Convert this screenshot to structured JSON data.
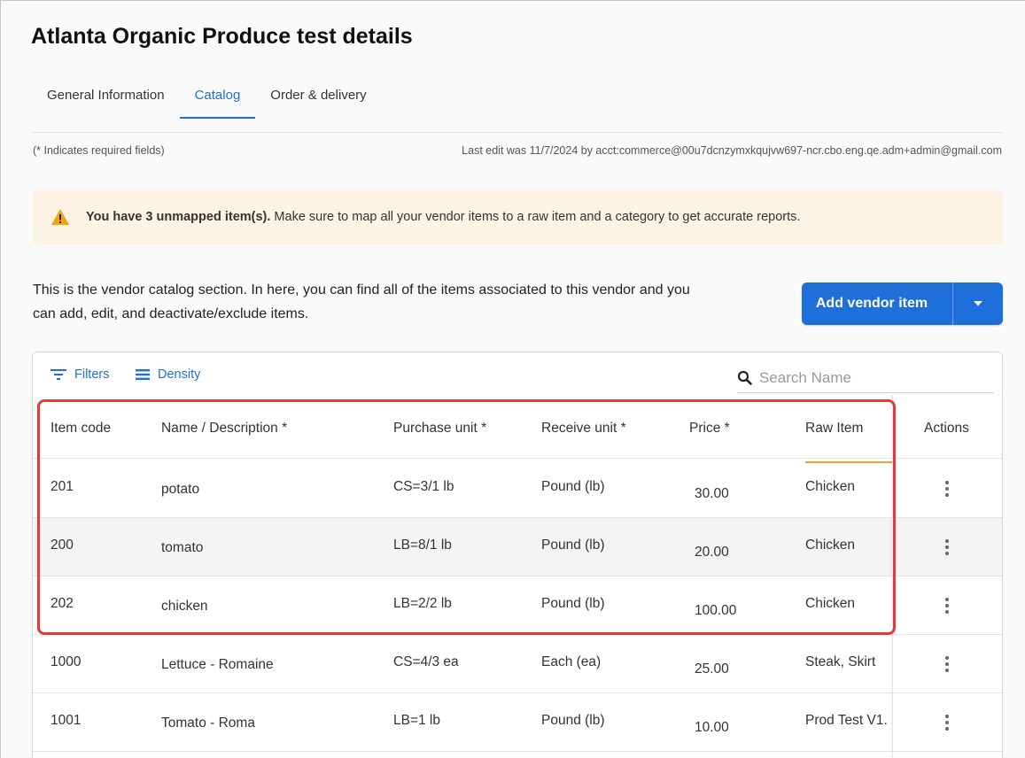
{
  "page": {
    "title": "Atlanta Organic Produce test details"
  },
  "tabs": [
    {
      "label": "General Information",
      "active": false
    },
    {
      "label": "Catalog",
      "active": true
    },
    {
      "label": "Order & delivery",
      "active": false
    }
  ],
  "meta": {
    "required_note": "(* Indicates required fields)",
    "last_edit": "Last edit was 11/7/2024 by acct:commerce@00u7dcnzymxkqujvw697-ncr.cbo.eng.qe.adm+admin@gmail.com"
  },
  "warning": {
    "icon": "warning-triangle-icon",
    "bold_text": "You have 3 unmapped item(s).",
    "text": "Make sure to map all your vendor items to a raw item and a category to get accurate reports."
  },
  "intro": {
    "text": "This is the vendor catalog section. In here, you can find all of the items associated to this vendor and you can add, edit, and deactivate/exclude items."
  },
  "add_button": {
    "label": "Add vendor item",
    "dropdown_icon": "caret-down-icon"
  },
  "toolbar": {
    "filters_label": "Filters",
    "density_label": "Density",
    "search_placeholder": "Search Name"
  },
  "table": {
    "headers": {
      "item_code": "Item code",
      "name": "Name / Description *",
      "purchase_unit": "Purchase unit *",
      "receive_unit": "Receive unit *",
      "price": "Price *",
      "raw_item": "Raw Item",
      "actions": "Actions"
    },
    "rows": [
      {
        "code": "201",
        "name": "potato",
        "purchase": "CS=3/1 lb",
        "receive": "Pound (lb)",
        "price": "30.00",
        "raw": "Chicken"
      },
      {
        "code": "200",
        "name": "tomato",
        "purchase": "LB=8/1 lb",
        "receive": "Pound (lb)",
        "price": "20.00",
        "raw": "Chicken"
      },
      {
        "code": "202",
        "name": "chicken",
        "purchase": "LB=2/2 lb",
        "receive": "Pound (lb)",
        "price": "100.00",
        "raw": "Chicken"
      },
      {
        "code": "1000",
        "name": "Lettuce - Romaine",
        "purchase": "CS=4/3 ea",
        "receive": "Each (ea)",
        "price": "25.00",
        "raw": "Steak, Skirt"
      },
      {
        "code": "1001",
        "name": "Tomato - Roma",
        "purchase": "LB=1 lb",
        "receive": "Pound (lb)",
        "price": "10.00",
        "raw": "Prod Test V1."
      }
    ]
  },
  "colors": {
    "accent": "#1e6fd9",
    "warning_bg": "#fdf3e4",
    "warning_icon": "#f2a20c",
    "highlight": "#e03c3c",
    "sort_underline": "#f0a623"
  }
}
